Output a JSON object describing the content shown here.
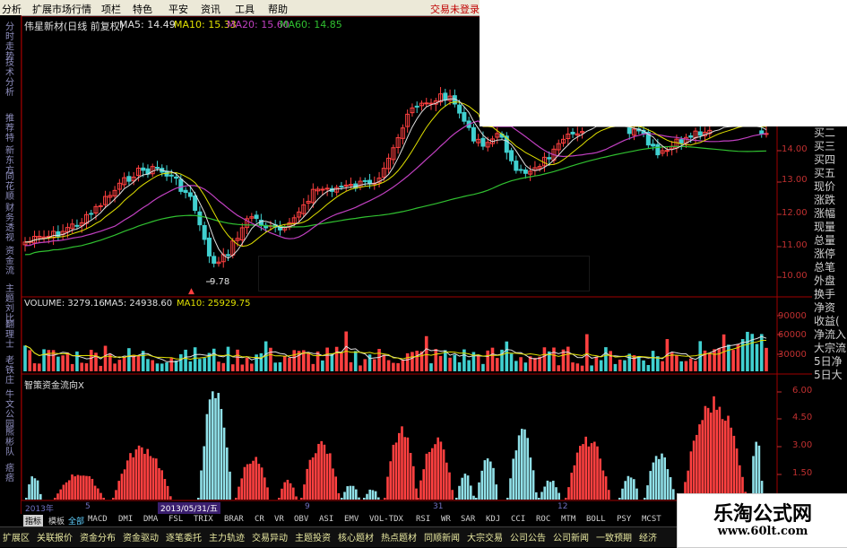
{
  "menubar": {
    "items": [
      "分析",
      "扩展市场行情",
      "项栏",
      "特色",
      "平安",
      "资讯",
      "工具",
      "帮助"
    ],
    "warning": "交易未登录"
  },
  "sidebar": {
    "tabs": [
      "分时走势",
      "技术分析",
      "推荐特",
      "新东方",
      "同花顺",
      "财务透视",
      "资金流",
      "主题刘比",
      "翻理士",
      "老铁庄",
      "牛文公园",
      "熊彬队",
      "痞痞"
    ]
  },
  "chart": {
    "stock_label": "伟星新材(日线 前复权)",
    "ma": [
      {
        "label": "MA5: 14.49",
        "color": "#e0e0e0"
      },
      {
        "label": "MA10: 15.33",
        "color": "#e0e000"
      },
      {
        "label": "MA20: 15.60",
        "color": "#c040c0"
      },
      {
        "label": "MA60: 14.85",
        "color": "#30c030"
      }
    ],
    "low_label": "9.78",
    "volume_label": "VOLUME: 3279.16",
    "vol_ma5": "MA5: 24938.60",
    "vol_ma10": "MA10: 25929.75",
    "indicator_title": "智策资金流向X",
    "price_ticks": [
      "14.00",
      "13.00",
      "12.00",
      "11.00",
      "10.00"
    ],
    "volume_ticks": [
      "90000",
      "60000",
      "30000"
    ],
    "ind_ticks": [
      "6.00",
      "4.50",
      "3.00",
      "1.50"
    ],
    "date_ticks": [
      "2013年",
      "5",
      "2013/05/31/五",
      "9",
      "31",
      "12"
    ],
    "colors": {
      "up": "#ff4040",
      "down": "#40d0d0",
      "ma5": "#e0e0e0",
      "ma10": "#e0e000",
      "ma20": "#c040c0",
      "ma60": "#30c030",
      "frame": "#a00000",
      "axis": "#c03030"
    }
  },
  "right_panel": {
    "items": [
      "买二",
      "买三",
      "买四",
      "买五",
      "现价",
      "涨跌",
      "涨幅",
      "现量",
      "总量",
      "涨停",
      "总笔",
      "外盘",
      "换手",
      "净资",
      "收益(",
      "净流入",
      "大宗流",
      "5日净",
      "5日大"
    ]
  },
  "indicators": {
    "active": "指标",
    "items": [
      "模板",
      "全部",
      "MACD",
      "DMI",
      "DMA",
      "FSL",
      "TRIX",
      "BRAR",
      "CR",
      "VR",
      "OBV",
      "ASI",
      "EMV",
      "VOL-TDX",
      "RSI",
      "WR",
      "SAR",
      "KDJ",
      "CCI",
      "ROC",
      "MTM",
      "BOLL",
      "PSY",
      "MCST"
    ]
  },
  "bottombar": {
    "items": [
      "扩展区",
      "关联报价",
      "资金分布",
      "资金驱动",
      "逐笔委托",
      "主力轨迹",
      "交易异动",
      "主题投资",
      "核心题材",
      "热点题材",
      "同顺新闻",
      "大宗交易",
      "公司公告",
      "公司新闻",
      "一致预期",
      "经济"
    ]
  },
  "watermark": {
    "title": "乐淘公式网",
    "url": "www.60lt.com"
  }
}
